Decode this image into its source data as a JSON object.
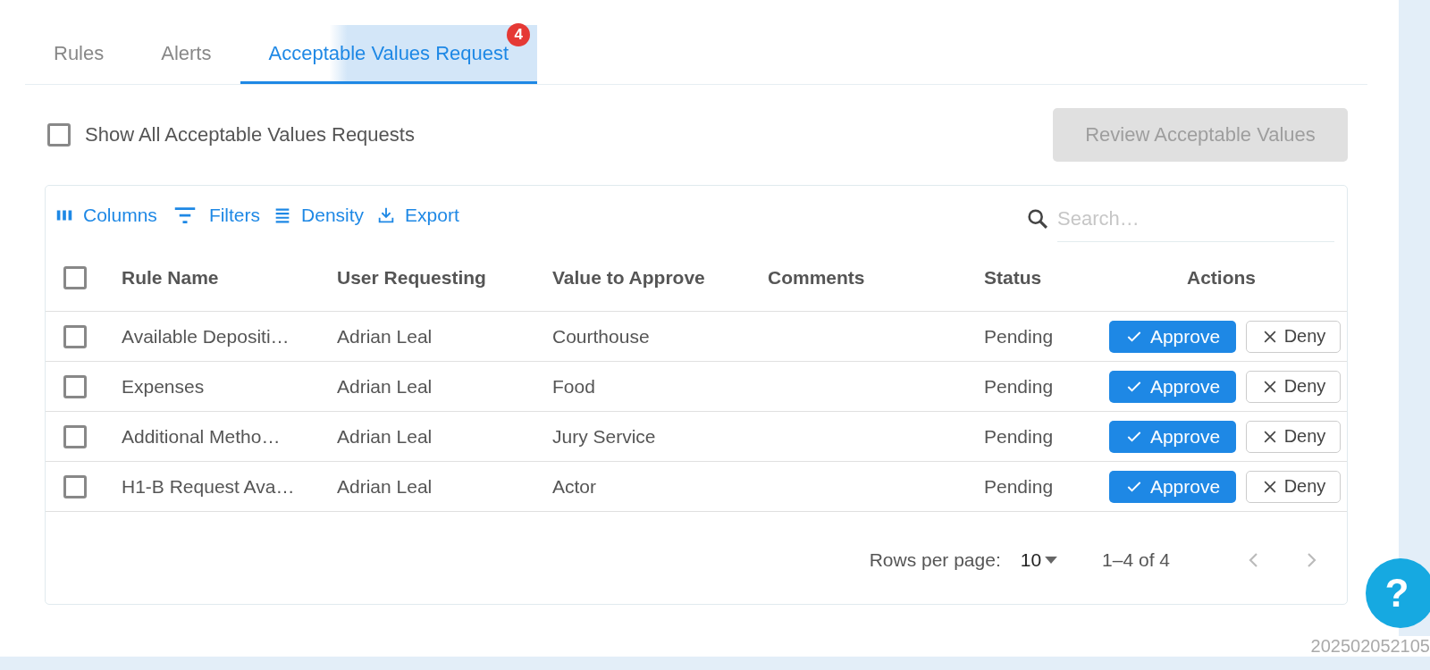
{
  "tabs": [
    {
      "label": "Rules",
      "selected": false
    },
    {
      "label": "Alerts",
      "selected": false
    },
    {
      "label": "Acceptable Values Request",
      "selected": true,
      "badge": "4"
    }
  ],
  "show_all": {
    "label": "Show All Acceptable Values Requests",
    "checked": false
  },
  "review_button": {
    "label": "Review Acceptable Values",
    "disabled": true
  },
  "toolbar": [
    {
      "kind": "columns",
      "label": "Columns"
    },
    {
      "kind": "filters",
      "label": "Filters"
    },
    {
      "kind": "density",
      "label": "Density"
    },
    {
      "kind": "export",
      "label": "Export"
    }
  ],
  "search": {
    "placeholder": "Search…"
  },
  "table": {
    "select_all": {
      "selected": false
    },
    "columns": [
      "Rule Name",
      "User Requesting",
      "Value to Approve",
      "Comments",
      "Status",
      "Actions"
    ],
    "rows": [
      {
        "selected": false,
        "rule_name": "Available Depositi…",
        "user": "Adrian Leal",
        "value": "Courthouse",
        "status": "Pending",
        "approve": "Approve",
        "deny": "Deny"
      },
      {
        "selected": false,
        "rule_name": "Expenses",
        "user": "Adrian Leal",
        "value": "Food",
        "status": "Pending",
        "approve": "Approve",
        "deny": "Deny"
      },
      {
        "selected": false,
        "rule_name": "Additional Metho…",
        "user": "Adrian Leal",
        "value": "Jury Service",
        "status": "Pending",
        "approve": "Approve",
        "deny": "Deny"
      },
      {
        "selected": false,
        "rule_name": "H1-B Request Ava…",
        "user": "Adrian Leal",
        "value": "Actor",
        "status": "Pending",
        "approve": "Approve",
        "deny": "Deny"
      }
    ]
  },
  "pagination": {
    "rows_per_page_label": "Rows per page:",
    "rows_per_page": "10",
    "range": "1–4 of 4",
    "prev_disabled": true,
    "next_disabled": true
  },
  "help_button": {
    "label": "?"
  },
  "timestamp": "202502052105"
}
